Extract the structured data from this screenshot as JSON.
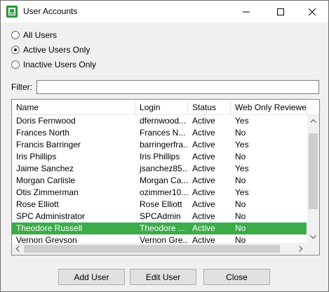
{
  "window": {
    "title": "User Accounts"
  },
  "filter_options": [
    {
      "label": "All Users",
      "checked": false
    },
    {
      "label": "Active Users Only",
      "checked": true
    },
    {
      "label": "Inactive Users Only",
      "checked": false
    }
  ],
  "filter": {
    "label": "Filter:",
    "value": ""
  },
  "table": {
    "columns": [
      "Name",
      "Login",
      "Status",
      "Web Only Reviewer"
    ],
    "rows": [
      {
        "name": "Doris Fernwood",
        "login": "dfernwood...",
        "status": "Active",
        "reviewer": "Yes"
      },
      {
        "name": "Frances North",
        "login": "Frances N...",
        "status": "Active",
        "reviewer": "No"
      },
      {
        "name": "Francis Barringer",
        "login": "barringerfra...",
        "status": "Active",
        "reviewer": "Yes"
      },
      {
        "name": "Iris Phillips",
        "login": "Iris Phillips",
        "status": "Active",
        "reviewer": "No"
      },
      {
        "name": "Jaime Sanchez",
        "login": "jsanchez85...",
        "status": "Active",
        "reviewer": "Yes"
      },
      {
        "name": "Morgan Carlisle",
        "login": "Morgan Ca...",
        "status": "Active",
        "reviewer": "No"
      },
      {
        "name": "Otis Zimmerman",
        "login": "ozimmer10...",
        "status": "Active",
        "reviewer": "Yes"
      },
      {
        "name": "Rose Elliott",
        "login": "Rose Elliott",
        "status": "Active",
        "reviewer": "No"
      },
      {
        "name": "SPC Administrator",
        "login": "SPCAdmin",
        "status": "Active",
        "reviewer": "No"
      },
      {
        "name": "Theodore Russell",
        "login": "Theodore ...",
        "status": "Active",
        "reviewer": "No",
        "selected": true
      },
      {
        "name": "Vernon Greyson",
        "login": "Vernon Gre...",
        "status": "Active",
        "reviewer": "No"
      }
    ]
  },
  "buttons": {
    "add": "Add User",
    "edit": "Edit User",
    "close": "Close"
  },
  "colors": {
    "selection": "#3cab4a",
    "app_icon": "#2e9e3e"
  },
  "icons": [
    "app-icon",
    "minimize-icon",
    "maximize-icon",
    "close-icon",
    "scroll-up-icon",
    "scroll-down-icon",
    "scroll-left-icon",
    "scroll-right-icon"
  ]
}
